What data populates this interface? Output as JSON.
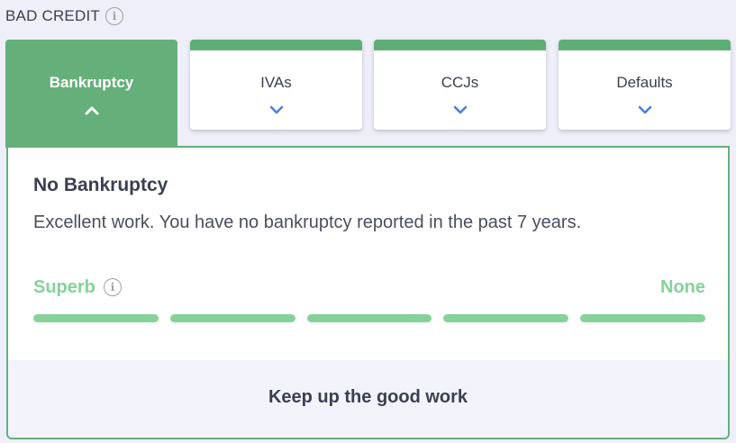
{
  "header": {
    "title": "BAD CREDIT",
    "info_icon": "info-icon"
  },
  "tabs": [
    {
      "label": "Bankruptcy",
      "active": true,
      "icon": "chevron-up-icon"
    },
    {
      "label": "IVAs",
      "active": false,
      "icon": "chevron-down-icon"
    },
    {
      "label": "CCJs",
      "active": false,
      "icon": "chevron-down-icon"
    },
    {
      "label": "Defaults",
      "active": false,
      "icon": "chevron-down-icon"
    }
  ],
  "panel": {
    "title": "No Bankruptcy",
    "description": "Excellent work. You have no bankruptcy reported in the past 7 years.",
    "rating_label": "Superb",
    "rating_value": "None",
    "rating_filled_segments": 5,
    "rating_total_segments": 5,
    "footer_text": "Keep up the good work"
  },
  "colors": {
    "accent_green": "#65b07a",
    "rating_green": "#86d29a",
    "chevron_blue": "#4f7fd8",
    "text_dark": "#3b3f52",
    "background": "#eeeff9"
  }
}
